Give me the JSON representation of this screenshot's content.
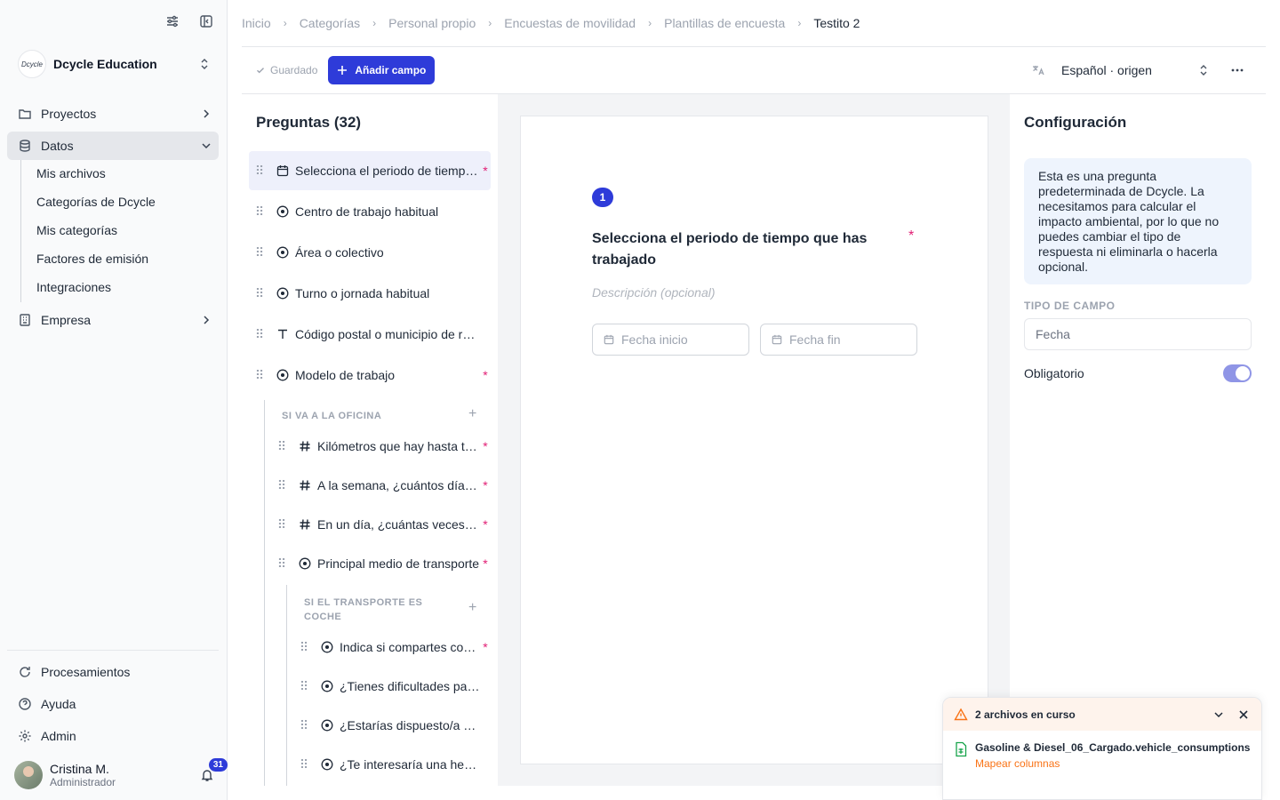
{
  "org": {
    "logo_text": "Dcycle",
    "name": "Dcycle Education"
  },
  "nav": {
    "projects": "Proyectos",
    "data": "Datos",
    "data_children": [
      "Mis archivos",
      "Categorías de Dcycle",
      "Mis categorías",
      "Factores de emisión",
      "Integraciones"
    ],
    "company": "Empresa",
    "processing": "Procesamientos",
    "help": "Ayuda",
    "admin": "Admin"
  },
  "user": {
    "name": "Cristina M.",
    "role": "Administrador",
    "notifications": "31"
  },
  "breadcrumb": [
    "Inicio",
    "Categorías",
    "Personal propio",
    "Encuestas de movilidad",
    "Plantillas de encuesta",
    "Testito 2"
  ],
  "toolbar": {
    "saved": "Guardado",
    "add_field": "Añadir campo",
    "language": "Español · origen"
  },
  "questions": {
    "title": "Preguntas (32)",
    "items": [
      {
        "text": "Selecciona el periodo de tiempo que has trabajado",
        "icon": "calendar-icon",
        "required": "*"
      },
      {
        "text": "Centro de trabajo habitual",
        "icon": "radio-icon",
        "required": ""
      },
      {
        "text": "Área o colectivo",
        "icon": "radio-icon",
        "required": ""
      },
      {
        "text": "Turno o jornada habitual",
        "icon": "radio-icon",
        "required": ""
      },
      {
        "text": "Código postal o municipio de residencia",
        "icon": "text-icon",
        "required": ""
      },
      {
        "text": "Modelo de trabajo",
        "icon": "radio-icon",
        "required": "*"
      }
    ],
    "section1": {
      "title": "SI VA A LA OFICINA",
      "items": [
        {
          "text": "Kilómetros que hay hasta tu centro de trabajo",
          "icon": "hash-icon",
          "required": "*"
        },
        {
          "text": "A la semana, ¿cuántos días vas a la oficina?",
          "icon": "hash-icon",
          "required": "*"
        },
        {
          "text": "En un día, ¿cuántas veces haces el trayecto?",
          "icon": "hash-icon",
          "required": "*"
        },
        {
          "text": "Principal medio de transporte",
          "icon": "radio-icon",
          "required": "*"
        }
      ]
    },
    "section2": {
      "title": "SI EL TRANSPORTE ES COCHE",
      "items": [
        {
          "text": "Indica si compartes coche",
          "icon": "radio-icon",
          "required": "*"
        },
        {
          "text": "¿Tienes dificultades para aparcar?",
          "icon": "radio-icon",
          "required": ""
        },
        {
          "text": "¿Estarías dispuesto/a a compartir coche?",
          "icon": "radio-icon",
          "required": ""
        },
        {
          "text": "¿Te interesaría una herramienta para compartir coche?",
          "icon": "radio-icon",
          "required": ""
        }
      ]
    }
  },
  "editor": {
    "number": "1",
    "heading": "Selecciona el periodo de tiempo que has trabajado",
    "required": "*",
    "description_placeholder": "Descripción (opcional)",
    "start_placeholder": "Fecha inicio",
    "end_placeholder": "Fecha fin"
  },
  "config": {
    "title": "Configuración",
    "info": "Esta es una pregunta predeterminada de Dcycle. La necesitamos para calcular el impacto ambiental, por lo que no puedes cambiar el tipo de respuesta ni eliminarla o hacerla opcional.",
    "field_type_label": "TIPO DE CAMPO",
    "field_type_value": "Fecha",
    "required_label": "Obligatorio",
    "required_on": true
  },
  "toast": {
    "title": "2 archivos en curso",
    "file_name": "Gasoline & Diesel_06_Cargado.vehicle_consumptions",
    "file_action": "Mapear columnas"
  },
  "colors": {
    "accent": "#2e3bd9",
    "required": "#e11d74",
    "warning": "#f97316"
  }
}
